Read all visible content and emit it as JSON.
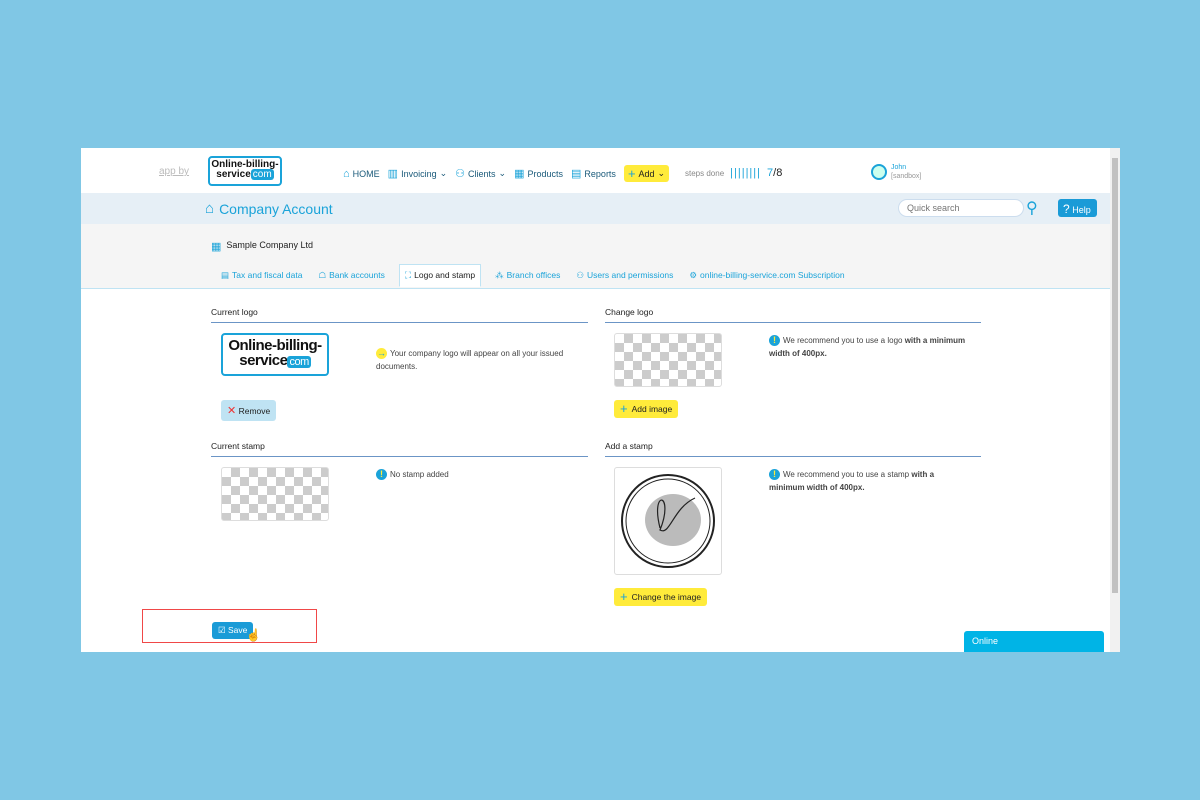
{
  "header": {
    "app_by": "app by",
    "logo_line1": "Online-billing-",
    "logo_line2": "service",
    "logo_com": "com",
    "nav": [
      {
        "label": "HOME",
        "icon": "home-icon"
      },
      {
        "label": "Invoicing",
        "icon": "invoice-icon",
        "dropdown": true
      },
      {
        "label": "Clients",
        "icon": "clients-icon",
        "dropdown": true
      },
      {
        "label": "Products",
        "icon": "products-icon"
      },
      {
        "label": "Reports",
        "icon": "reports-icon"
      }
    ],
    "add_label": "Add",
    "steps_label": "steps done",
    "steps_bars": "||||||||",
    "steps_done": "7",
    "steps_total": "8",
    "user_name": "John",
    "user_sub": "[sandbox]"
  },
  "band": {
    "title": "Company Account",
    "search_placeholder": "Quick search",
    "help_label": "Help"
  },
  "company": "Sample Company Ltd",
  "tabs": [
    {
      "label": "Tax and fiscal data"
    },
    {
      "label": "Bank accounts"
    },
    {
      "label": "Logo and stamp",
      "active": true
    },
    {
      "label": "Branch offices"
    },
    {
      "label": "Users and permissions"
    },
    {
      "label": "online-billing-service.com Subscription"
    }
  ],
  "logo_section": {
    "current_title": "Current logo",
    "current_note": "Your company logo will appear on all your issued documents.",
    "remove_label": "Remove",
    "change_title": "Change logo",
    "recommend_pre": "We recommend you to use a logo ",
    "recommend_bold": "with a minimum width of 400px.",
    "add_image_label": "Add image"
  },
  "stamp_section": {
    "current_title": "Current stamp",
    "no_stamp": "No stamp added",
    "add_title": "Add a stamp",
    "recommend_pre": "We recommend you to use a stamp ",
    "recommend_bold": "with a minimum width of 400px.",
    "change_label": "Change the image"
  },
  "save_label": "Save",
  "chat_label": "Online",
  "colors": {
    "accent": "#1aa3d9",
    "yellow": "#ffeb3b",
    "background": "#80c7e5",
    "highlight": "#f04848"
  }
}
